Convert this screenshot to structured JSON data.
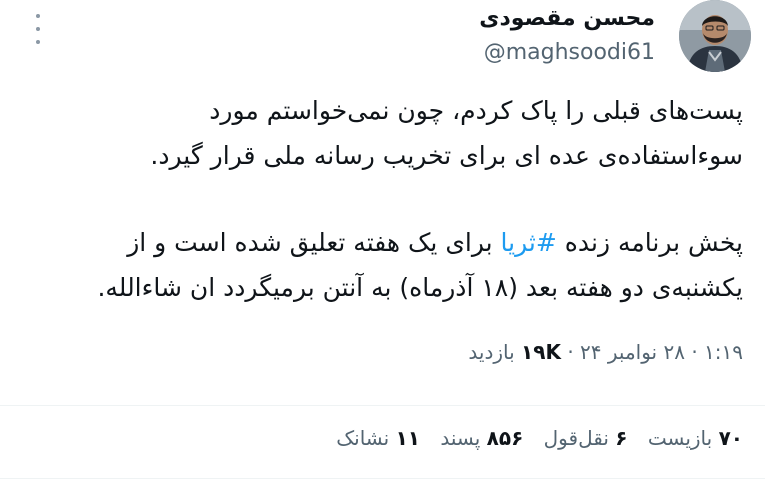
{
  "author": {
    "display_name": "محسن مقصودی",
    "handle": "@maghsoodi61",
    "avatar_icon": "avatar-photo"
  },
  "tweet": {
    "paragraph1_line1": "پست‌های قبلی را پاک کردم، چون نمی‌خواستم مورد",
    "paragraph1_line2": "سوءاستفاده‌ی عده ای برای تخریب رسانه ملی قرار گیرد.",
    "paragraph2_line1_before": "پخش برنامه زنده ",
    "hashtag": "#ثریا",
    "paragraph2_line1_after": " برای یک هفته تعلیق شده است و از",
    "paragraph2_line2": "یکشنبه‌ی دو هفته بعد (۱۸ آذرماه) به آنتن برمیگردد ان شاءالله."
  },
  "meta": {
    "time": "۱:۱۹",
    "date": "۲۸ نوامبر ۲۴",
    "separator": "·",
    "views_count": "۱۹K",
    "views_label": "بازدید"
  },
  "stats": {
    "retweets_count": "۷۰",
    "retweets_label": "بازیست",
    "quotes_count": "۶",
    "quotes_label": "نقل‌قول",
    "likes_count": "۸۵۶",
    "likes_label": "پسند",
    "bookmarks_count": "۱۱",
    "bookmarks_label": "نشانک"
  },
  "colors": {
    "text": "#0f1419",
    "secondary": "#536471",
    "link": "#1d9bf0",
    "divider": "#eff3f4"
  }
}
